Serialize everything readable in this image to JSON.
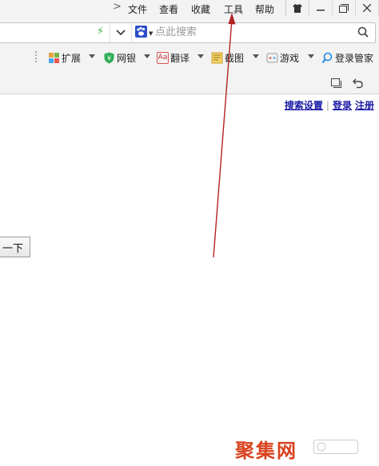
{
  "menu": {
    "arrow": ">",
    "items": [
      "文件",
      "查看",
      "收藏",
      "工具",
      "帮助"
    ]
  },
  "window_buttons": [
    "skin-icon",
    "minimize-icon",
    "restore-icon",
    "close-icon"
  ],
  "address_bar": {
    "search_placeholder": "点此搜索"
  },
  "toolbar": {
    "items": [
      {
        "label": "扩展",
        "icon": "extensions-icon"
      },
      {
        "label": "网银",
        "icon": "bank-shield-icon"
      },
      {
        "label": "翻译",
        "icon": "translate-icon",
        "icon_text": "Aa"
      },
      {
        "label": "截图",
        "icon": "screenshot-icon"
      },
      {
        "label": "游戏",
        "icon": "game-icon"
      },
      {
        "label": "登录管家",
        "icon": "login-manager-icon"
      }
    ]
  },
  "page": {
    "links": [
      "搜索设置",
      "登录",
      "注册"
    ],
    "search_button": "一下"
  },
  "watermark": {
    "text": "聚集网"
  },
  "colors": {
    "link": "#1a1aa6",
    "arrow": "#b22222",
    "watermark": "#d9421f",
    "engine": "#2d4ec9"
  }
}
